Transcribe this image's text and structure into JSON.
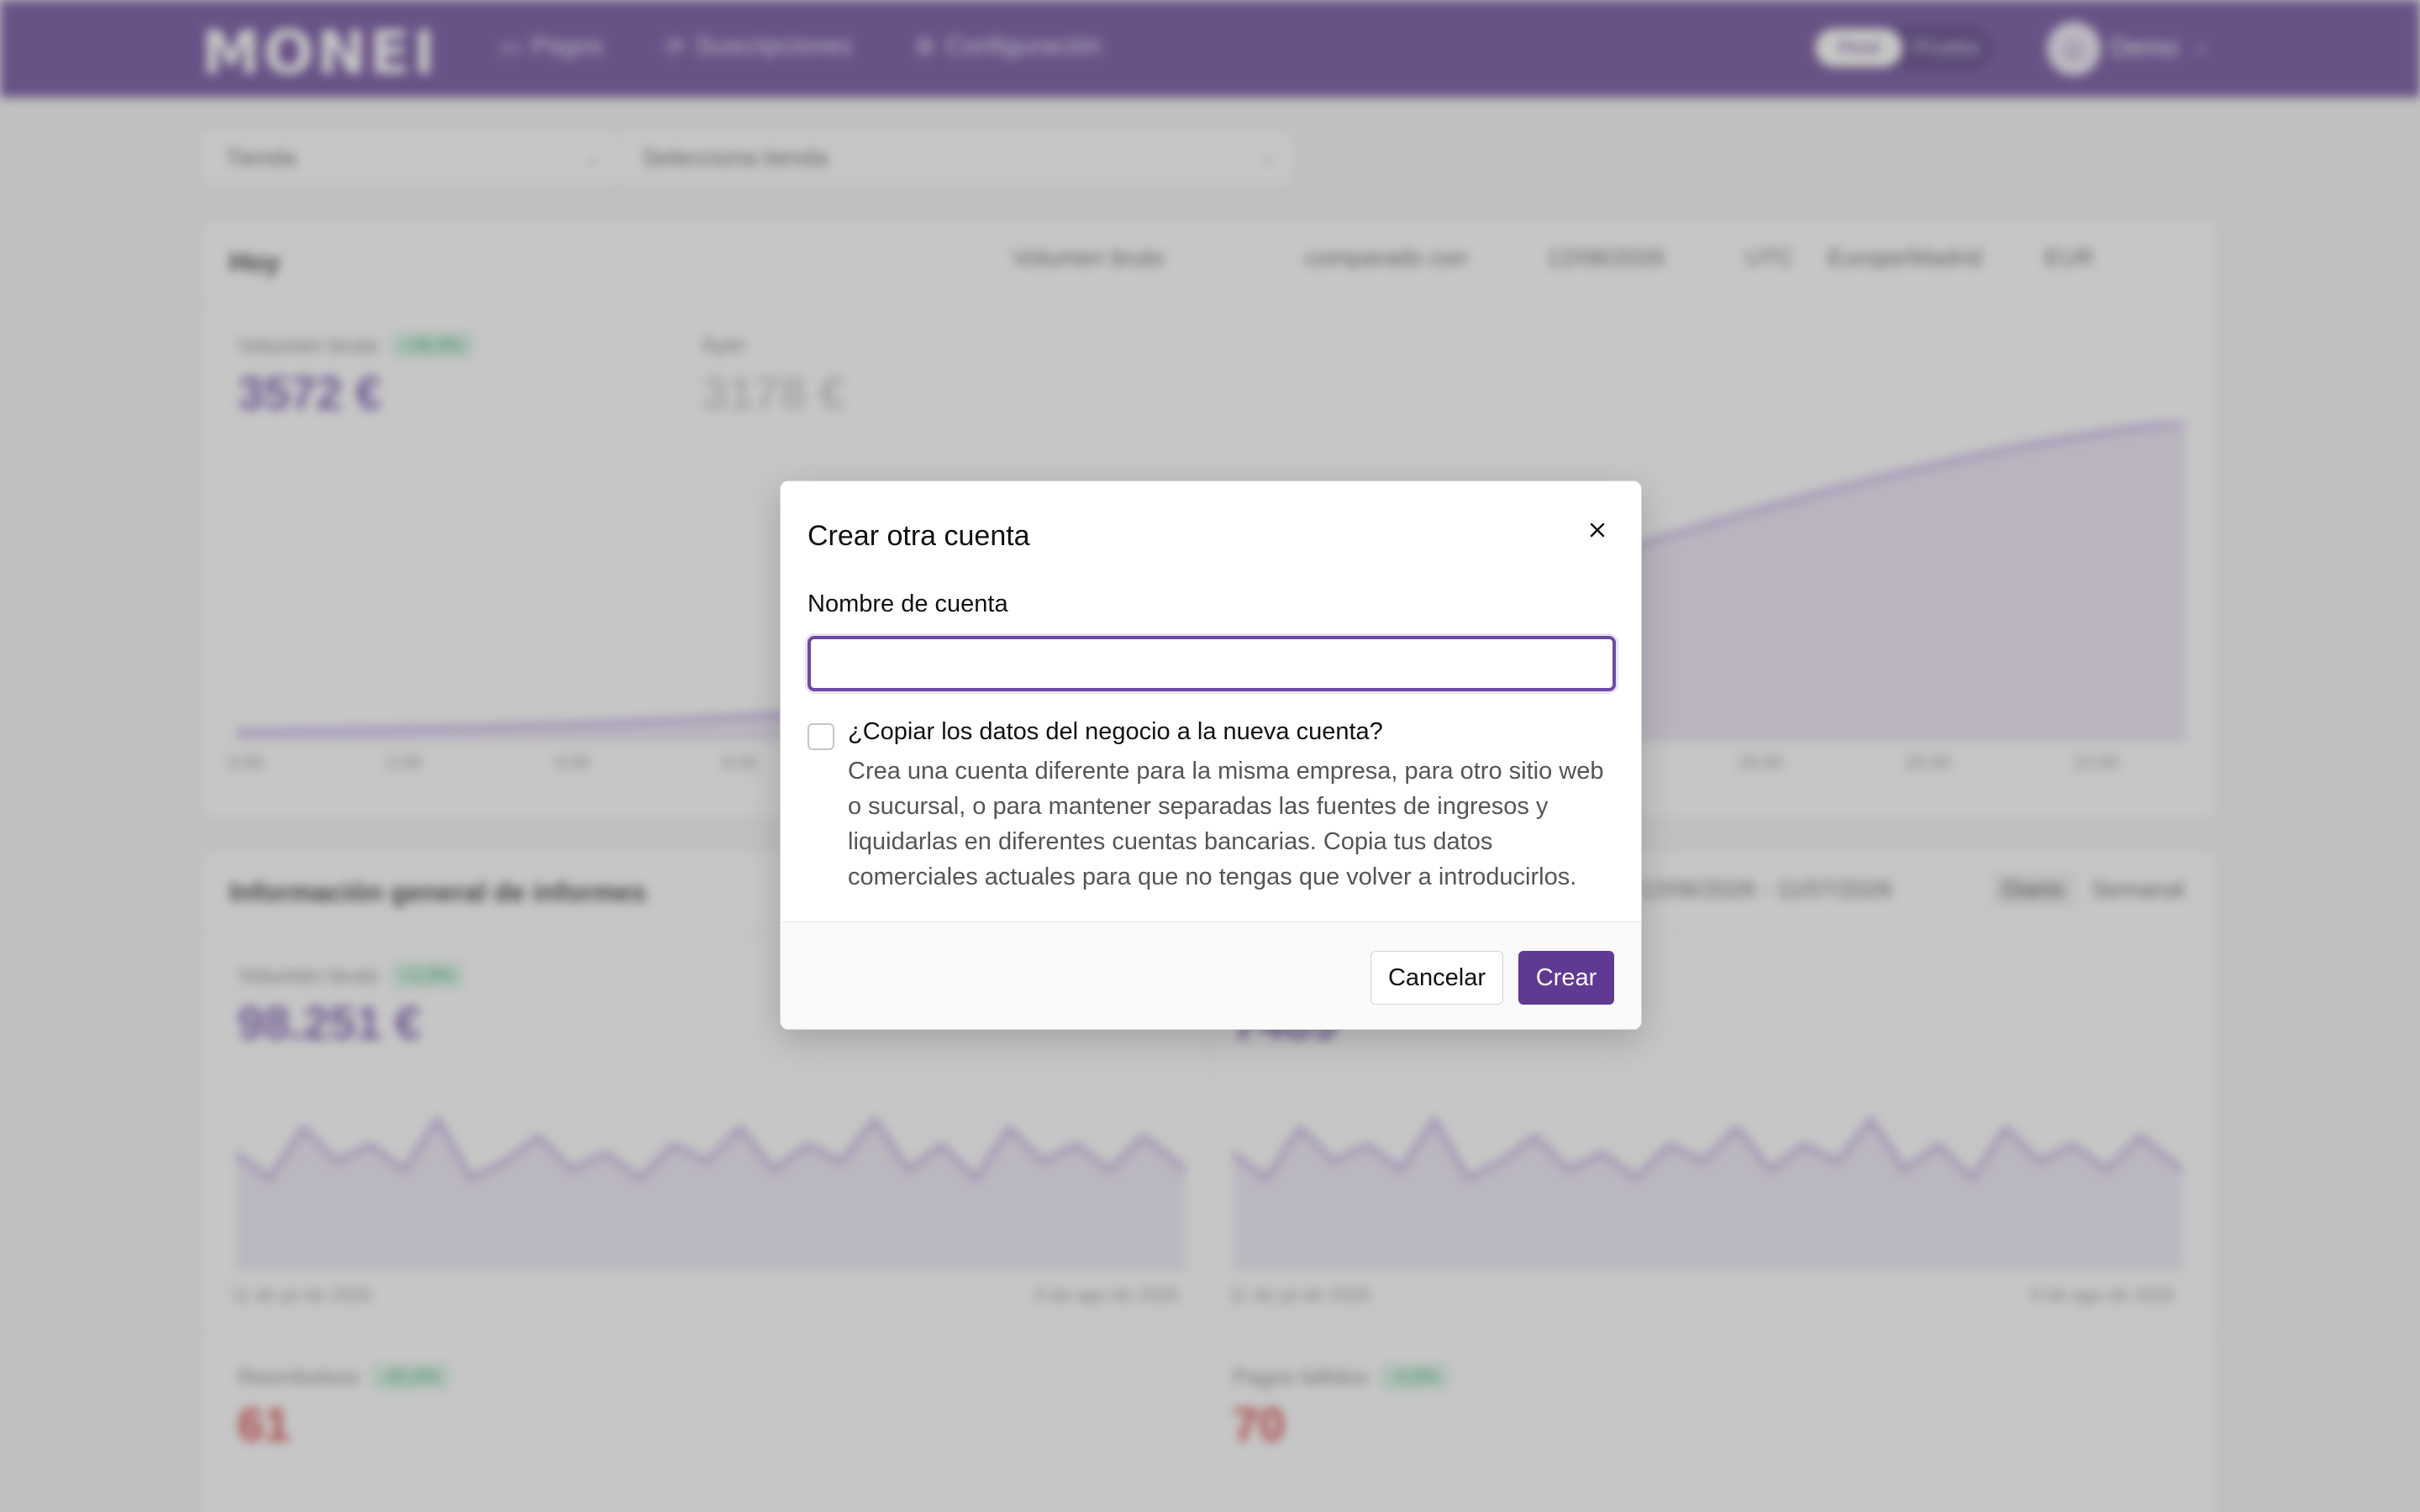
{
  "colors": {
    "brand": "#5f3a92",
    "accent": "#6e4aa8",
    "positive": "#1b9e5a",
    "negative": "#d0312d"
  },
  "topbar": {
    "logo": "MONEI",
    "nav": [
      {
        "label": "Pagos",
        "icon": "card-icon"
      },
      {
        "label": "Suscripciones",
        "icon": "refresh-icon"
      },
      {
        "label": "Configuración",
        "icon": "gear-icon"
      }
    ],
    "mode_toggle": [
      "Real",
      "Prueba"
    ],
    "user_name": "Demo"
  },
  "filters": {
    "store_label": "Tienda",
    "store_placeholder": "Selecciona tienda"
  },
  "today_card": {
    "title": "Hoy",
    "metric_select": "Volumen bruto",
    "compared_label": "comparado con",
    "compare_date": "12/08/2026",
    "tz_label": "UTC",
    "tz_value": "Europe/Madrid",
    "currency": "EUR",
    "primary_label": "Volumen bruto",
    "primary_change": "+36,9%",
    "primary_value": "3572 €",
    "secondary_label": "Ayer",
    "secondary_value": "3178 €",
    "x_ticks": [
      "0:00",
      "2:00",
      "4:00",
      "6:00",
      "18:00",
      "20:00",
      "22:00"
    ]
  },
  "reports_card": {
    "title": "Información general de informes",
    "range": "12/06/2026 - 11/07/2026",
    "seg_daily": "Diario",
    "seg_weekly": "Semanal",
    "gross_label": "Volumen bruto",
    "gross_change": "+2,9%",
    "gross_value": "98.251 €",
    "second_value": "7489",
    "left_start": "11 de jul de 2026",
    "left_end": "9 de ago de 2026",
    "right_start": "11 de jul de 2026",
    "right_end": "9 de ago de 2026",
    "refunds_label": "Reembolsos",
    "refunds_change": "-20,4%",
    "refunds_value": "61",
    "failed_label": "Pagos fallidos",
    "failed_change": "-4,6%",
    "failed_value": "70"
  },
  "modal": {
    "title": "Crear otra cuenta",
    "field_label": "Nombre de cuenta",
    "field_value": "",
    "checkbox_label": "¿Copiar los datos del negocio a la nueva cuenta?",
    "checkbox_checked": false,
    "description": "Crea una cuenta diferente para la misma empresa, para otro sitio web o sucursal, o para mantener separadas las fuentes de ingresos y liquidarlas en diferentes cuentas bancarias. Copia tus datos comerciales actuales para que no tengas que volver a introducirlos.",
    "cancel_label": "Cancelar",
    "create_label": "Crear",
    "close_icon": "close-icon"
  }
}
